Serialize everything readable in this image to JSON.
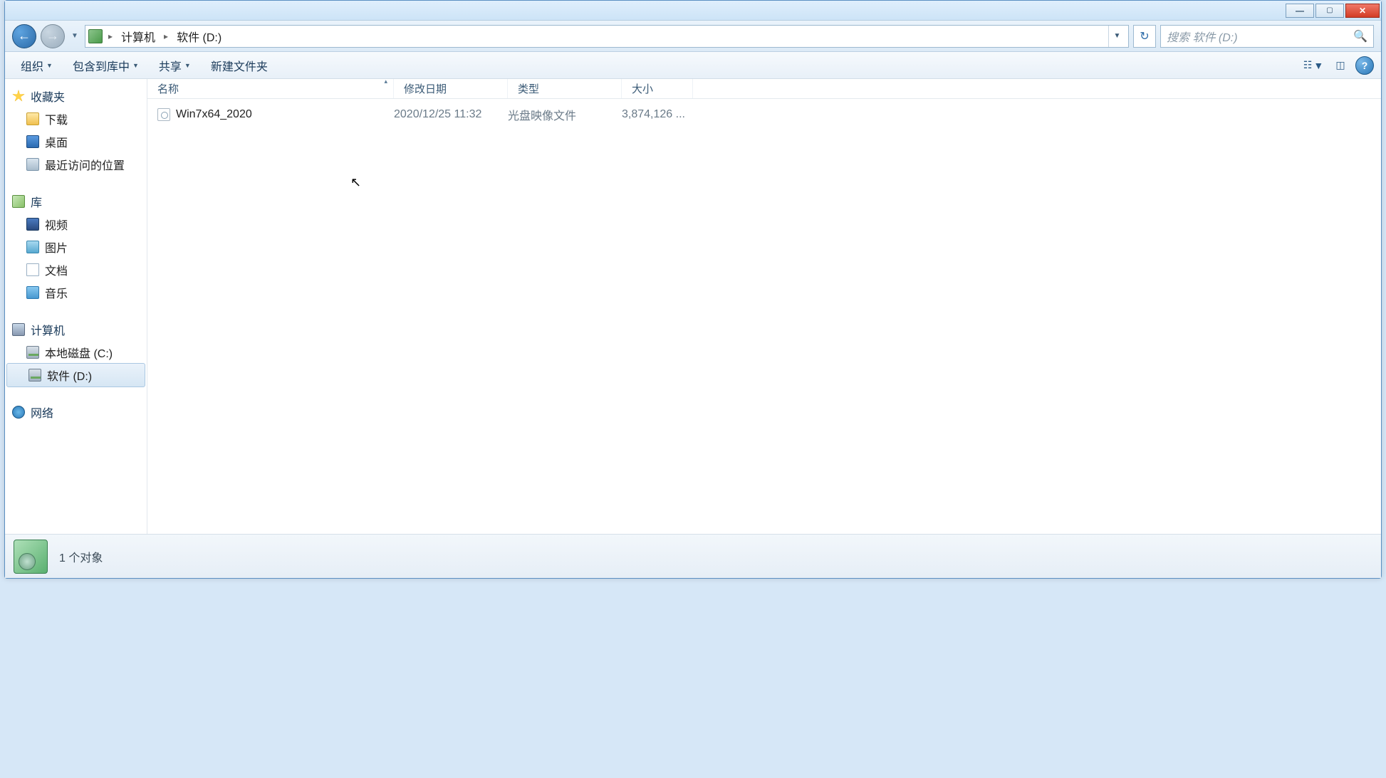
{
  "breadcrumb": {
    "seg1": "计算机",
    "seg2": "软件 (D:)"
  },
  "search": {
    "placeholder": "搜索 软件 (D:)"
  },
  "toolbar": {
    "organize": "组织",
    "include": "包含到库中",
    "share": "共享",
    "newfolder": "新建文件夹"
  },
  "sidebar": {
    "favorites": "收藏夹",
    "downloads": "下载",
    "desktop": "桌面",
    "recent": "最近访问的位置",
    "libraries": "库",
    "videos": "视频",
    "pictures": "图片",
    "documents": "文档",
    "music": "音乐",
    "computer": "计算机",
    "drive_c": "本地磁盘 (C:)",
    "drive_d": "软件 (D:)",
    "network": "网络"
  },
  "columns": {
    "name": "名称",
    "date": "修改日期",
    "type": "类型",
    "size": "大小"
  },
  "files": [
    {
      "name": "Win7x64_2020",
      "date": "2020/12/25 11:32",
      "type": "光盘映像文件",
      "size": "3,874,126 ..."
    }
  ],
  "status": {
    "text": "1 个对象"
  }
}
